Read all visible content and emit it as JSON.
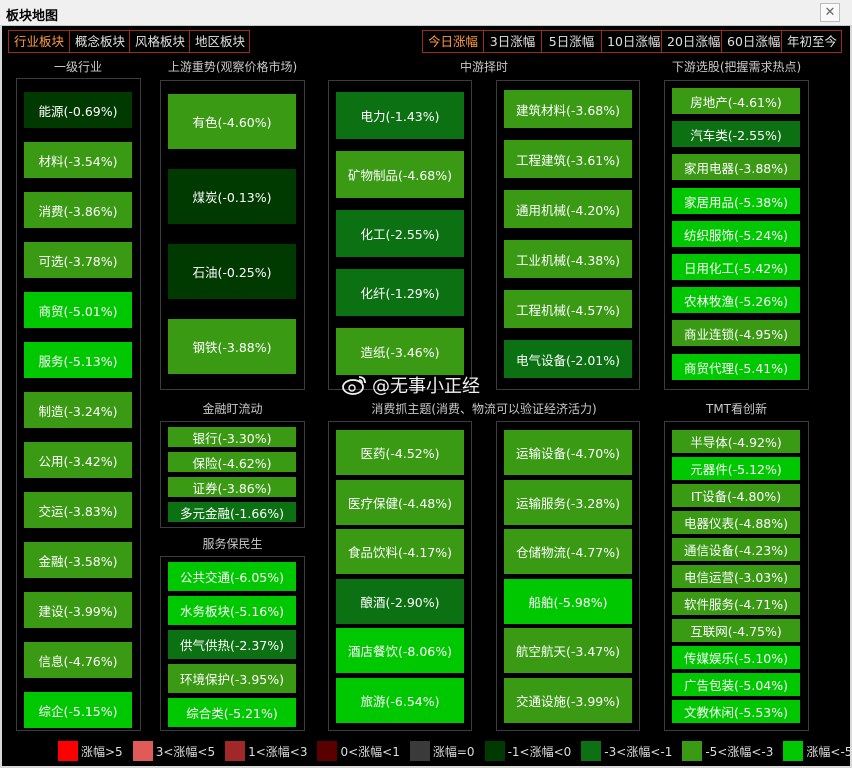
{
  "window": {
    "title": "板块地图"
  },
  "tabs_left": [
    "行业板块",
    "概念板块",
    "风格板块",
    "地区板块"
  ],
  "tabs_left_active": 0,
  "tabs_right": [
    "今日涨幅",
    "3日涨幅",
    "5日涨幅",
    "10日涨幅",
    "20日涨幅",
    "60日涨幅",
    "年初至今"
  ],
  "tabs_right_active": 0,
  "colors": {
    "c1": "#003a00",
    "c3": "#0c7112",
    "c5": "#3a9a14",
    "c6": "#00c800",
    "tab_active": "#ff9a3c",
    "tab_border": "#a02a1a",
    "legend_up5": "#ff0000",
    "legend_3_5": "#e05a5a",
    "legend_1_3": "#a02828",
    "legend_0_1": "#5a0000",
    "legend_zero": "#3a3a3a"
  },
  "sections": [
    {
      "key": "level1",
      "title": "一级行业",
      "tiles": [
        {
          "label": "能源(-0.69%)",
          "c": "c1"
        },
        {
          "label": "材料(-3.54%)",
          "c": "c5"
        },
        {
          "label": "消费(-3.86%)",
          "c": "c5"
        },
        {
          "label": "可选(-3.78%)",
          "c": "c5"
        },
        {
          "label": "商贸(-5.01%)",
          "c": "c6"
        },
        {
          "label": "服务(-5.13%)",
          "c": "c6"
        },
        {
          "label": "制造(-3.24%)",
          "c": "c5"
        },
        {
          "label": "公用(-3.42%)",
          "c": "c5"
        },
        {
          "label": "交运(-3.83%)",
          "c": "c5"
        },
        {
          "label": "金融(-3.58%)",
          "c": "c5"
        },
        {
          "label": "建设(-3.99%)",
          "c": "c5"
        },
        {
          "label": "信息(-4.76%)",
          "c": "c5"
        },
        {
          "label": "综企(-5.15%)",
          "c": "c6"
        }
      ]
    },
    {
      "key": "upstream",
      "title": "上游重势(观察价格市场)",
      "tiles": [
        {
          "label": "有色(-4.60%)",
          "c": "c5"
        },
        {
          "label": "煤炭(-0.13%)",
          "c": "c1"
        },
        {
          "label": "石油(-0.25%)",
          "c": "c1"
        },
        {
          "label": "钢铁(-3.88%)",
          "c": "c5"
        }
      ]
    },
    {
      "key": "mid_a",
      "title": "中游择时",
      "tiles": [
        {
          "label": "电力(-1.43%)",
          "c": "c3"
        },
        {
          "label": "矿物制品(-4.68%)",
          "c": "c5"
        },
        {
          "label": "化工(-2.55%)",
          "c": "c3"
        },
        {
          "label": "化纤(-1.29%)",
          "c": "c3"
        },
        {
          "label": "造纸(-3.46%)",
          "c": "c5"
        }
      ]
    },
    {
      "key": "mid_b",
      "title": "",
      "tiles": [
        {
          "label": "建筑材料(-3.68%)",
          "c": "c5"
        },
        {
          "label": "工程建筑(-3.61%)",
          "c": "c5"
        },
        {
          "label": "通用机械(-4.20%)",
          "c": "c5"
        },
        {
          "label": "工业机械(-4.38%)",
          "c": "c5"
        },
        {
          "label": "工程机械(-4.57%)",
          "c": "c5"
        },
        {
          "label": "电气设备(-2.01%)",
          "c": "c3"
        }
      ]
    },
    {
      "key": "downstream",
      "title": "下游选股(把握需求热点)",
      "tiles": [
        {
          "label": "房地产(-4.61%)",
          "c": "c5"
        },
        {
          "label": "汽车类(-2.55%)",
          "c": "c3"
        },
        {
          "label": "家用电器(-3.88%)",
          "c": "c5"
        },
        {
          "label": "家居用品(-5.38%)",
          "c": "c6"
        },
        {
          "label": "纺织服饰(-5.24%)",
          "c": "c6"
        },
        {
          "label": "日用化工(-5.42%)",
          "c": "c6"
        },
        {
          "label": "农林牧渔(-5.26%)",
          "c": "c6"
        },
        {
          "label": "商业连锁(-4.95%)",
          "c": "c5"
        },
        {
          "label": "商贸代理(-5.41%)",
          "c": "c6"
        }
      ]
    },
    {
      "key": "finance",
      "title": "金融盯流动",
      "tiles": [
        {
          "label": "银行(-3.30%)",
          "c": "c5"
        },
        {
          "label": "保险(-4.62%)",
          "c": "c5"
        },
        {
          "label": "证券(-3.86%)",
          "c": "c5"
        },
        {
          "label": "多元金融(-1.66%)",
          "c": "c3"
        }
      ]
    },
    {
      "key": "service",
      "title": "服务保民生",
      "tiles": [
        {
          "label": "公共交通(-6.05%)",
          "c": "c6"
        },
        {
          "label": "水务板块(-5.16%)",
          "c": "c6"
        },
        {
          "label": "供气供热(-2.37%)",
          "c": "c3"
        },
        {
          "label": "环境保护(-3.95%)",
          "c": "c5"
        },
        {
          "label": "综合类(-5.21%)",
          "c": "c6"
        }
      ]
    },
    {
      "key": "consume_a",
      "title": "消费抓主题(消费、物流可以验证经济活力)",
      "tiles": [
        {
          "label": "医药(-4.52%)",
          "c": "c5"
        },
        {
          "label": "医疗保健(-4.48%)",
          "c": "c5"
        },
        {
          "label": "食品饮料(-4.17%)",
          "c": "c5"
        },
        {
          "label": "酿酒(-2.90%)",
          "c": "c3"
        },
        {
          "label": "酒店餐饮(-8.06%)",
          "c": "c6"
        },
        {
          "label": "旅游(-6.54%)",
          "c": "c6"
        }
      ]
    },
    {
      "key": "consume_b",
      "title": "",
      "tiles": [
        {
          "label": "运输设备(-4.70%)",
          "c": "c5"
        },
        {
          "label": "运输服务(-3.28%)",
          "c": "c5"
        },
        {
          "label": "仓储物流(-4.77%)",
          "c": "c5"
        },
        {
          "label": "船舶(-5.98%)",
          "c": "c6"
        },
        {
          "label": "航空航天(-3.47%)",
          "c": "c5"
        },
        {
          "label": "交通设施(-3.99%)",
          "c": "c5"
        }
      ]
    },
    {
      "key": "tmt",
      "title": "TMT看创新",
      "tiles": [
        {
          "label": "半导体(-4.92%)",
          "c": "c5"
        },
        {
          "label": "元器件(-5.12%)",
          "c": "c6"
        },
        {
          "label": "IT设备(-4.80%)",
          "c": "c5"
        },
        {
          "label": "电器仪表(-4.88%)",
          "c": "c5"
        },
        {
          "label": "通信设备(-4.23%)",
          "c": "c5"
        },
        {
          "label": "电信运营(-3.03%)",
          "c": "c5"
        },
        {
          "label": "软件服务(-4.71%)",
          "c": "c5"
        },
        {
          "label": "互联网(-4.75%)",
          "c": "c5"
        },
        {
          "label": "传媒娱乐(-5.10%)",
          "c": "c6"
        },
        {
          "label": "广告包装(-5.04%)",
          "c": "c6"
        },
        {
          "label": "文教休闲(-5.53%)",
          "c": "c6"
        }
      ]
    }
  ],
  "watermark": {
    "text": "@无事小正经",
    "icon": "weibo-icon"
  },
  "legend": [
    {
      "label": "涨幅>5",
      "c": "legend_up5"
    },
    {
      "label": "3<涨幅<5",
      "c": "legend_3_5"
    },
    {
      "label": "1<涨幅<3",
      "c": "legend_1_3"
    },
    {
      "label": "0<涨幅<1",
      "c": "legend_0_1"
    },
    {
      "label": "涨幅=0",
      "c": "legend_zero"
    },
    {
      "label": "-1<涨幅<0",
      "c": "c1"
    },
    {
      "label": "-3<涨幅<-1",
      "c": "c3"
    },
    {
      "label": "-5<涨幅<-3",
      "c": "c5"
    },
    {
      "label": "涨幅<-5",
      "c": "c6"
    }
  ]
}
